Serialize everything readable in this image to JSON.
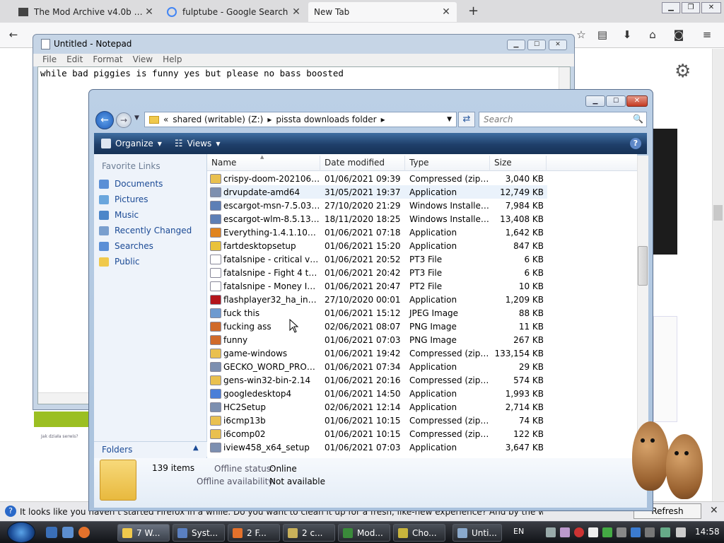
{
  "firefox": {
    "tabs": [
      {
        "title": "The Mod Archive v4.0b - A..."
      },
      {
        "title": "fulptube - Google Search"
      },
      {
        "title": "New Tab"
      }
    ],
    "notification_text": "It looks like you haven’t started Firefox in a while. Do you want to clean it up for a fresh, like-new experience? And by the way, welcome back!",
    "refresh_button": "Refresh Firefox..."
  },
  "notepad": {
    "title": "Untitled - Notepad",
    "menu": [
      "File",
      "Edit",
      "Format",
      "View",
      "Help"
    ],
    "text": "while bad piggies is funny yes but please no bass boosted",
    "side_note": "Jak działa serwis?"
  },
  "explorer": {
    "breadcrumb": [
      "«",
      "shared (writable) (Z:)",
      "pissta downloads folder"
    ],
    "search_placeholder": "Search",
    "toolbar": {
      "organize": "Organize",
      "views": "Views"
    },
    "nav": {
      "heading": "Favorite Links",
      "items": [
        "Documents",
        "Pictures",
        "Music",
        "Recently Changed",
        "Searches",
        "Public"
      ],
      "folders": "Folders"
    },
    "columns": [
      "Name",
      "Date modified",
      "Type",
      "Size"
    ],
    "files": [
      {
        "name": "crispy-doom-20210601...",
        "date": "01/06/2021 09:39",
        "type": "Compressed (zipp...",
        "size": "3,040 KB",
        "icon": "zip-folder-icon"
      },
      {
        "name": "drvupdate-amd64",
        "date": "31/05/2021 19:37",
        "type": "Application",
        "size": "12,749 KB",
        "icon": "application-icon"
      },
      {
        "name": "escargot-msn-7.5.0324...",
        "date": "27/10/2020 21:29",
        "type": "Windows Installer ...",
        "size": "7,984 KB",
        "icon": "installer-icon"
      },
      {
        "name": "escargot-wlm-8.5.1302...",
        "date": "18/11/2020 18:25",
        "type": "Windows Installer ...",
        "size": "13,408 KB",
        "icon": "installer-icon"
      },
      {
        "name": "Everything-1.4.1.1005.x...",
        "date": "01/06/2021 07:18",
        "type": "Application",
        "size": "1,642 KB",
        "icon": "magnifier-icon"
      },
      {
        "name": "fartdesktopsetup",
        "date": "01/06/2021 15:20",
        "type": "Application",
        "size": "847 KB",
        "icon": "smiley-icon"
      },
      {
        "name": "fatalsnipe - critical vol...",
        "date": "01/06/2021 20:52",
        "type": "PT3 File",
        "size": "6 KB",
        "icon": "blank-file-icon"
      },
      {
        "name": "fatalsnipe - Fight 4 the ...",
        "date": "01/06/2021 20:42",
        "type": "PT3 File",
        "size": "6 KB",
        "icon": "blank-file-icon"
      },
      {
        "name": "fatalsnipe - Money Inv...",
        "date": "01/06/2021 20:47",
        "type": "PT2 File",
        "size": "10 KB",
        "icon": "blank-file-icon"
      },
      {
        "name": "flashplayer32_ha_install",
        "date": "27/10/2020 00:01",
        "type": "Application",
        "size": "1,209 KB",
        "icon": "flash-icon"
      },
      {
        "name": "fuck this",
        "date": "01/06/2021 15:12",
        "type": "JPEG Image",
        "size": "88 KB",
        "icon": "image-icon"
      },
      {
        "name": "fucking ass",
        "date": "02/06/2021 08:07",
        "type": "PNG Image",
        "size": "11 KB",
        "icon": "png-image-icon"
      },
      {
        "name": "funny",
        "date": "01/06/2021 07:03",
        "type": "PNG Image",
        "size": "267 KB",
        "icon": "png-image-icon"
      },
      {
        "name": "game-windows",
        "date": "01/06/2021 19:42",
        "type": "Compressed (zipp...",
        "size": "133,154 KB",
        "icon": "zip-folder-icon"
      },
      {
        "name": "GECKO_WORD_PROCE...",
        "date": "01/06/2021 07:34",
        "type": "Application",
        "size": "29 KB",
        "icon": "application-icon"
      },
      {
        "name": "gens-win32-bin-2.14",
        "date": "01/06/2021 20:16",
        "type": "Compressed (zipp...",
        "size": "574 KB",
        "icon": "zip-folder-icon"
      },
      {
        "name": "googledesktop4",
        "date": "01/06/2021 14:50",
        "type": "Application",
        "size": "1,993 KB",
        "icon": "google-icon"
      },
      {
        "name": "HC2Setup",
        "date": "02/06/2021 12:14",
        "type": "Application",
        "size": "2,714 KB",
        "icon": "application-icon"
      },
      {
        "name": "i6cmp13b",
        "date": "01/06/2021 10:15",
        "type": "Compressed (zipp...",
        "size": "74 KB",
        "icon": "zip-folder-icon"
      },
      {
        "name": "i6comp02",
        "date": "01/06/2021 10:15",
        "type": "Compressed (zipp...",
        "size": "122 KB",
        "icon": "zip-folder-icon"
      },
      {
        "name": "iview458_x64_setup",
        "date": "01/06/2021 07:03",
        "type": "Application",
        "size": "3,647 KB",
        "icon": "application-icon"
      }
    ],
    "details": {
      "count": "139 items",
      "offline_status_label": "Offline status:",
      "offline_status_value": "Online",
      "offline_avail_label": "Offline availability:",
      "offline_avail_value": "Not available"
    }
  },
  "taskbar": {
    "tasks": [
      "7 W...",
      "Syst...",
      "2 F...",
      "2 c...",
      "Mod...",
      "Cho...",
      "Unti..."
    ],
    "lang": "EN",
    "clock": "14:58"
  },
  "colors": {
    "accent": "#1b4a95",
    "toolbar": "#1f3f6a",
    "title": "#bcd0e6"
  }
}
